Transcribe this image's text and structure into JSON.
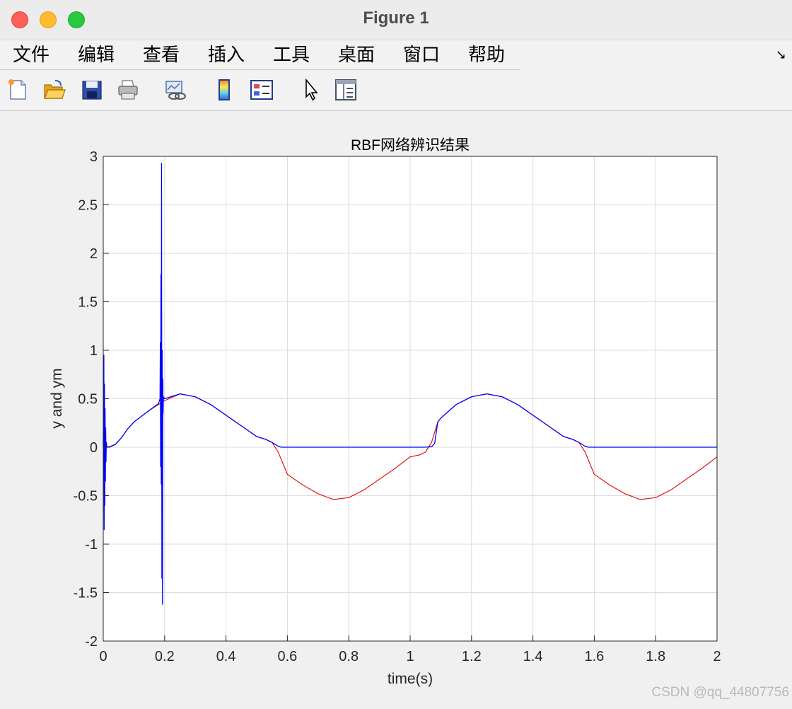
{
  "window": {
    "title": "Figure 1"
  },
  "menu": [
    "文件",
    "编辑",
    "查看",
    "插入",
    "工具",
    "桌面",
    "窗口",
    "帮助"
  ],
  "menu_corner_glyph": "↘",
  "toolbar": {
    "icons": [
      "new-figure-icon",
      "open-file-icon",
      "save-icon",
      "print-icon",
      "link-plot-icon",
      "insert-colorbar-icon",
      "insert-legend-icon",
      "edit-plot-pointer-icon",
      "property-inspector-icon"
    ]
  },
  "watermark": "CSDN @qq_44807756",
  "chart_data": {
    "type": "line",
    "title": "RBF网络辨识结果",
    "xlabel": "time(s)",
    "ylabel": "y and ym",
    "xlim": [
      0,
      2
    ],
    "ylim": [
      -2,
      3
    ],
    "xticks": [
      "0",
      "0.2",
      "0.4",
      "0.6",
      "0.8",
      "1",
      "1.2",
      "1.4",
      "1.6",
      "1.8",
      "2"
    ],
    "yticks": [
      "-2",
      "-1.5",
      "-1",
      "-0.5",
      "0",
      "0.5",
      "1",
      "1.5",
      "2",
      "2.5",
      "3"
    ],
    "grid": true,
    "colors": {
      "red": "#e60000",
      "blue": "#0000ff"
    },
    "series": [
      {
        "color": "red",
        "x": [
          0,
          0.02,
          0.04,
          0.06,
          0.08,
          0.1,
          0.15,
          0.2,
          0.25,
          0.3,
          0.35,
          0.4,
          0.45,
          0.5,
          0.53,
          0.55,
          0.57,
          0.6,
          0.65,
          0.7,
          0.75,
          0.8,
          0.85,
          0.9,
          0.95,
          1.0,
          1.03,
          1.05,
          1.07,
          1.09,
          1.1,
          1.15,
          1.2,
          1.25,
          1.3,
          1.35,
          1.4,
          1.45,
          1.5,
          1.53,
          1.55,
          1.57,
          1.6,
          1.65,
          1.7,
          1.75,
          1.8,
          1.85,
          1.9,
          1.95,
          2.0
        ],
        "y": [
          0,
          0.005,
          0.03,
          0.1,
          0.19,
          0.26,
          0.38,
          0.48,
          0.55,
          0.52,
          0.44,
          0.33,
          0.22,
          0.11,
          0.08,
          0.05,
          -0.05,
          -0.28,
          -0.39,
          -0.48,
          -0.54,
          -0.52,
          -0.44,
          -0.33,
          -0.22,
          -0.1,
          -0.08,
          -0.05,
          0.05,
          0.26,
          0.3,
          0.44,
          0.52,
          0.55,
          0.52,
          0.44,
          0.33,
          0.22,
          0.11,
          0.08,
          0.05,
          -0.05,
          -0.28,
          -0.39,
          -0.48,
          -0.54,
          -0.52,
          -0.44,
          -0.33,
          -0.22,
          -0.1
        ]
      },
      {
        "color": "blue",
        "x": [
          0,
          0.002,
          0.003,
          0.004,
          0.005,
          0.006,
          0.007,
          0.008,
          0.009,
          0.01,
          0.012,
          0.015,
          0.02,
          0.04,
          0.06,
          0.08,
          0.1,
          0.15,
          0.18,
          0.185,
          0.186,
          0.187,
          0.188,
          0.189,
          0.19,
          0.191,
          0.192,
          0.193,
          0.194,
          0.195,
          0.196,
          0.2,
          0.25,
          0.3,
          0.35,
          0.4,
          0.45,
          0.5,
          0.53,
          0.55,
          0.57,
          0.58,
          0.6,
          0.7,
          0.8,
          0.9,
          1.0,
          1.05,
          1.07,
          1.08,
          1.09,
          1.1,
          1.15,
          1.2,
          1.25,
          1.3,
          1.35,
          1.4,
          1.45,
          1.5,
          1.53,
          1.55,
          1.57,
          1.58,
          1.6,
          1.7,
          1.8,
          1.9,
          2.0
        ],
        "y": [
          0,
          0.95,
          -0.85,
          0.65,
          -0.6,
          0.4,
          -0.35,
          0.2,
          -0.15,
          0.05,
          0,
          0,
          0,
          0.03,
          0.1,
          0.19,
          0.26,
          0.38,
          0.45,
          0.5,
          1.08,
          -0.2,
          1.78,
          -0.38,
          2.93,
          -1.35,
          1.0,
          -1.62,
          0.7,
          0.35,
          0.52,
          0.5,
          0.55,
          0.52,
          0.44,
          0.33,
          0.22,
          0.11,
          0.08,
          0.05,
          0.01,
          0,
          0,
          0,
          0,
          0,
          0,
          0,
          0.005,
          0.04,
          0.26,
          0.3,
          0.44,
          0.52,
          0.55,
          0.52,
          0.44,
          0.33,
          0.22,
          0.11,
          0.08,
          0.05,
          0.01,
          0,
          0,
          0,
          0,
          0,
          0
        ]
      }
    ]
  }
}
